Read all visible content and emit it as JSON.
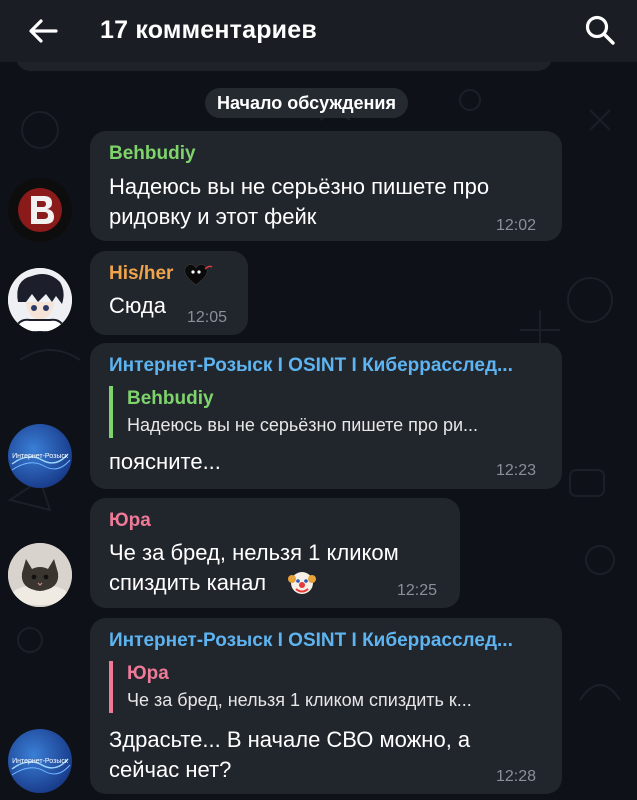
{
  "header": {
    "title": "17 комментариев",
    "back_icon": "arrow-left-icon",
    "search_icon": "search-icon"
  },
  "discussion_start": "Начало обсуждения",
  "colors": {
    "background": "#0e1117",
    "bubble": "#21252c",
    "author_green": "#7ed36b",
    "author_orange": "#f1a54b",
    "author_blue": "#5eb4f0",
    "author_pink": "#ee7a98",
    "time": "#8a9099"
  },
  "messages": [
    {
      "author": "Behbudiy",
      "author_color": "#7ed36b",
      "text_lines": [
        "Надеюсь вы не серьёзно пишете про",
        "ридовку и этот фейк"
      ],
      "time": "12:02",
      "avatar": "behbudiy-logo-avatar"
    },
    {
      "author": "His/her",
      "author_color": "#f1a54b",
      "author_emoji": "black-heart-icon",
      "text_lines": [
        "Сюда"
      ],
      "time": "12:05",
      "avatar": "anime-boy-avatar"
    },
    {
      "author": "Интернет-Розыск I OSINT I Киберрасслед...",
      "author_color": "#5eb4f0",
      "reply": {
        "author": "Behbudiy",
        "author_color": "#7ed36b",
        "text": "Надеюсь вы не серьёзно пишете про ри..."
      },
      "text_lines": [
        "поясните..."
      ],
      "time": "12:23",
      "avatar": "internet-rozysk-avatar",
      "avatar_text": "Интернет-Розыск"
    },
    {
      "author": "Юра",
      "author_color": "#ee7a98",
      "text_lines": [
        "Че за бред, нельзя 1 кликом",
        "спиздить канал"
      ],
      "text_emoji": "clown-face-icon",
      "time": "12:25",
      "avatar": "kitten-avatar"
    },
    {
      "author": "Интернет-Розыск I OSINT I Киберрасслед...",
      "author_color": "#5eb4f0",
      "reply": {
        "author": "Юра",
        "author_color": "#ee7a98",
        "text": "Че за бред, нельзя 1 кликом спиздить к..."
      },
      "text_lines": [
        "Здрасьте... В начале СВО можно, а",
        "сейчас нет?"
      ],
      "time": "12:28",
      "avatar": "internet-rozysk-avatar",
      "avatar_text": "Интернет-Розыск"
    }
  ]
}
